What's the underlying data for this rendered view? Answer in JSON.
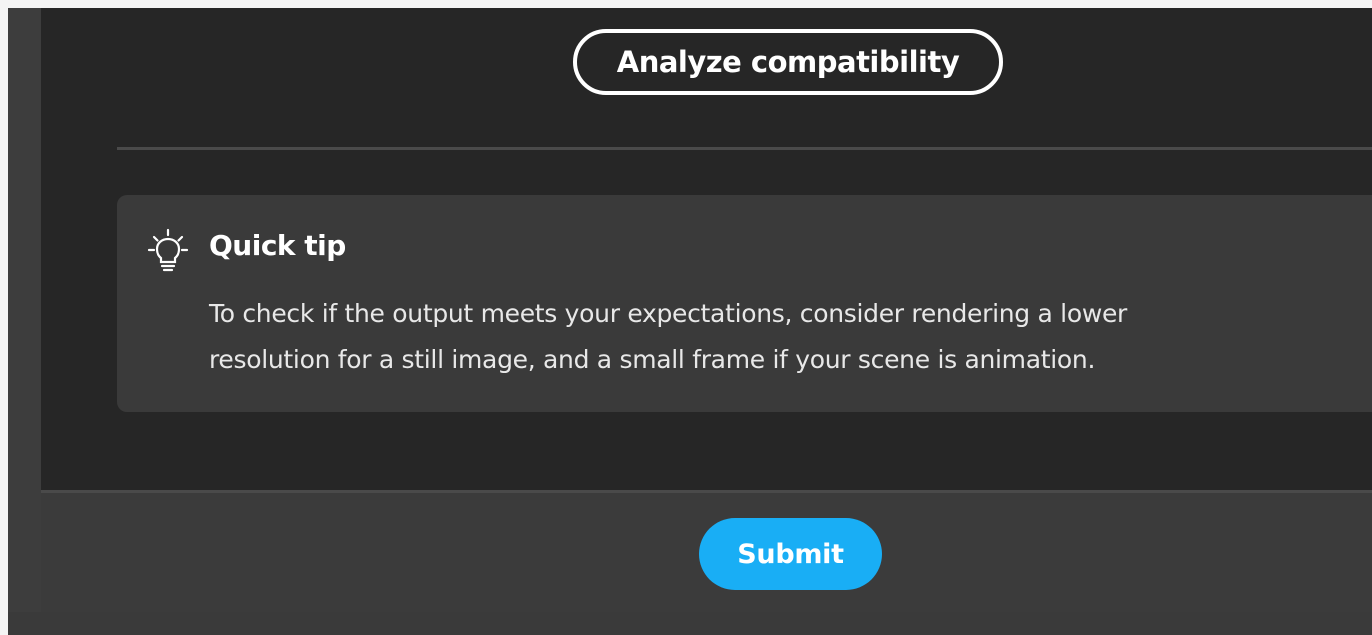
{
  "actions": {
    "analyze_label": "Analyze compatibility"
  },
  "tip": {
    "icon": "lightbulb-icon",
    "title": "Quick tip",
    "body_line1": "To check if the output meets your expectations, consider rendering a lower",
    "body_line2": "resolution for a still image, and a small frame if your scene is animation."
  },
  "footer": {
    "submit_label": "Submit"
  },
  "colors": {
    "panel_bg": "#262626",
    "card_bg": "#3a3a3a",
    "accent": "#19aef5",
    "text": "#ffffff"
  }
}
